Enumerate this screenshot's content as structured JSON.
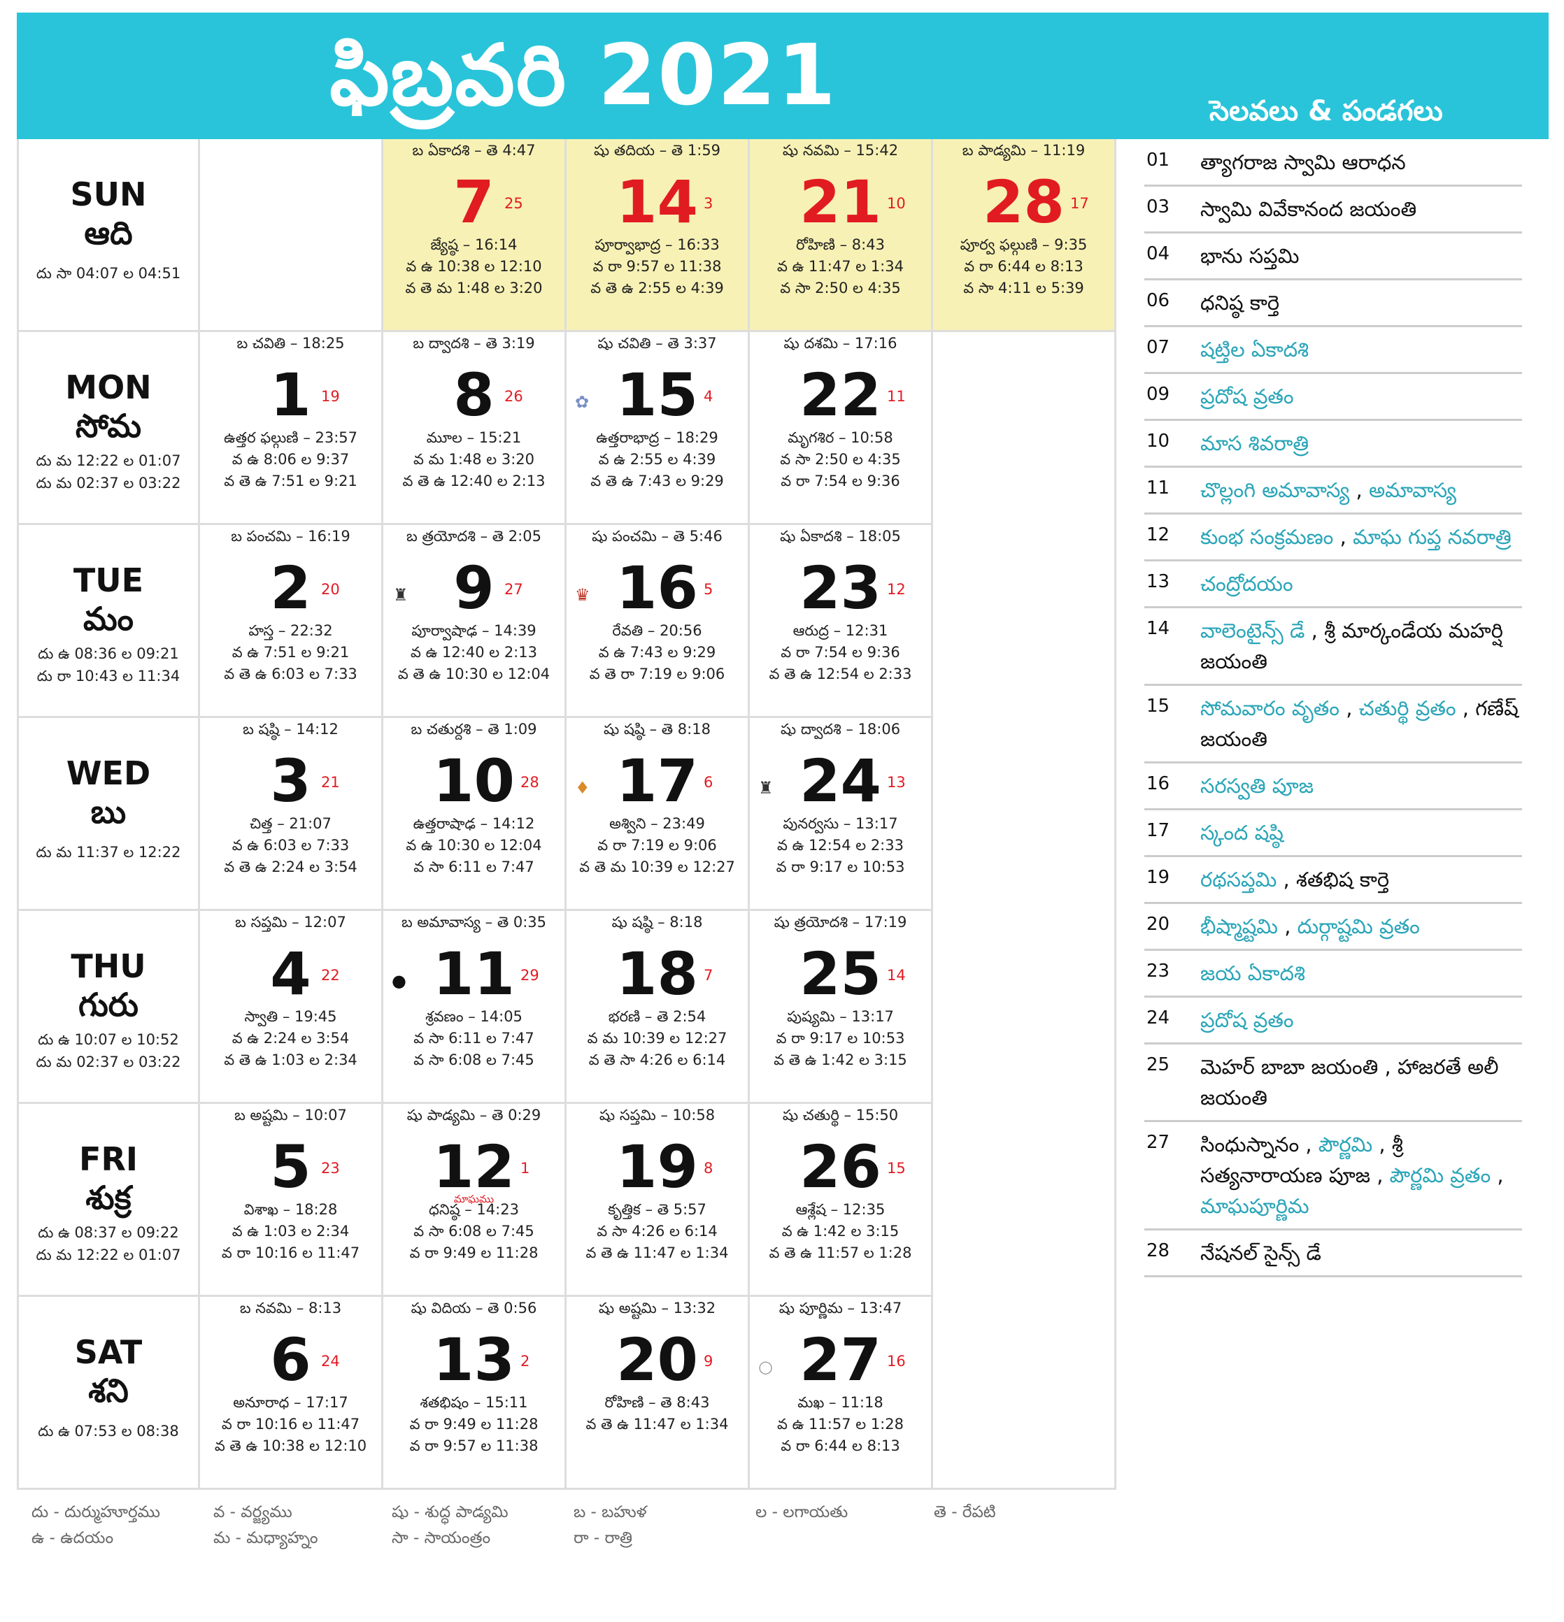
{
  "title": "ఫిబ్రవరి 2021",
  "festivals_title": "సెలవలు & పండగలు",
  "days": [
    {
      "en": "SUN",
      "te": "ఆది",
      "times": [
        "దు సా 04:07 ల 04:51"
      ]
    },
    {
      "en": "MON",
      "te": "సోమ",
      "times": [
        "దు మ 12:22 ల 01:07",
        "దు మ 02:37 ల 03:22"
      ]
    },
    {
      "en": "TUE",
      "te": "మం",
      "times": [
        "దు ఉ 08:36 ల 09:21",
        "దు రా 10:43 ల 11:34"
      ]
    },
    {
      "en": "WED",
      "te": "బు",
      "times": [
        "దు మ 11:37 ల 12:22"
      ]
    },
    {
      "en": "THU",
      "te": "గురు",
      "times": [
        "దు ఉ 10:07 ల 10:52",
        "దు మ 02:37 ల 03:22"
      ]
    },
    {
      "en": "FRI",
      "te": "శుక్ర",
      "times": [
        "దు ఉ 08:37 ల 09:22",
        "దు మ 12:22 ల 01:07"
      ]
    },
    {
      "en": "SAT",
      "te": "శని",
      "times": [
        "దు ఉ 07:53 ల 08:38"
      ]
    }
  ],
  "cells": [
    {
      "row": 0,
      "col": 1,
      "sun": true,
      "tithi": "బ ఏకాదశి – తె 4:47",
      "date": "7",
      "tdate": "25",
      "nak": "జ్యేష్ఠ – 16:14",
      "l1": "వ ఉ 10:38 ల 12:10",
      "l2": "వ తె మ 1:48 ల 3:20"
    },
    {
      "row": 0,
      "col": 2,
      "sun": true,
      "tithi": "షు తదియ – తె 1:59",
      "date": "14",
      "tdate": "3",
      "nak": "పూర్వాభాద్ర – 16:33",
      "l1": "వ రా 9:57 ల 11:38",
      "l2": "వ తె ఉ 2:55 ల 4:39"
    },
    {
      "row": 0,
      "col": 3,
      "sun": true,
      "tithi": "షు నవమి – 15:42",
      "date": "21",
      "tdate": "10",
      "nak": "రోహిణి – 8:43",
      "l1": "వ ఉ 11:47 ల 1:34",
      "l2": "వ సా 2:50 ల 4:35"
    },
    {
      "row": 0,
      "col": 4,
      "sun": true,
      "tithi": "బ పాడ్యమి – 11:19",
      "date": "28",
      "tdate": "17",
      "nak": "పూర్వ ఫల్గుణి – 9:35",
      "l1": "వ రా 6:44 ల 8:13",
      "l2": "వ సా 4:11 ల 5:39"
    },
    {
      "row": 1,
      "col": 0,
      "tithi": "బ చవితి – 18:25",
      "date": "1",
      "tdate": "19",
      "nak": "ఉత్తర ఫల్గుణి – 23:57",
      "l1": "వ ఉ 8:06 ల 9:37",
      "l2": "వ తె ఉ 7:51 ల 9:21"
    },
    {
      "row": 1,
      "col": 1,
      "tithi": "బ ద్వాదశి – తె 3:19",
      "date": "8",
      "tdate": "26",
      "nak": "మూల – 15:21",
      "l1": "వ మ 1:48 ల 3:20",
      "l2": "వ తె ఉ 12:40 ల 2:13"
    },
    {
      "row": 1,
      "col": 2,
      "tithi": "షు చవితి – తె 3:37",
      "date": "15",
      "tdate": "4",
      "nak": "ఉత్తరాభాద్ర – 18:29",
      "l1": "వ ఉ 2:55 ల 4:39",
      "l2": "వ తె ఉ 7:43 ల 9:29",
      "icon": "ganesha-icon",
      "glyph": "✿",
      "icolor": "#7a8fc4"
    },
    {
      "row": 1,
      "col": 3,
      "tithi": "షు దశమి – 17:16",
      "date": "22",
      "tdate": "11",
      "nak": "మృగశిర – 10:58",
      "l1": "వ సా 2:50 ల 4:35",
      "l2": "వ రా 7:54 ల 9:36"
    },
    {
      "row": 2,
      "col": 0,
      "tithi": "బ పంచమి – 16:19",
      "date": "2",
      "tdate": "20",
      "nak": "హస్త – 22:32",
      "l1": "వ ఉ 7:51 ల 9:21",
      "l2": "వ తె ఉ 6:03 ల 7:33"
    },
    {
      "row": 2,
      "col": 1,
      "tithi": "బ త్రయోదశి – తె 2:05",
      "date": "9",
      "tdate": "27",
      "nak": "పూర్వాషాఢ – 14:39",
      "l1": "వ ఉ 12:40 ల 2:13",
      "l2": "వ తె ఉ 10:30 ల 12:04",
      "icon": "shivalinga-icon",
      "glyph": "♜",
      "icolor": "#333"
    },
    {
      "row": 2,
      "col": 2,
      "tithi": "షు పంచమి – తె 5:46",
      "date": "16",
      "tdate": "5",
      "nak": "రేవతి – 20:56",
      "l1": "వ ఉ 7:43 ల 9:29",
      "l2": "వ తె రా 7:19 ల 9:06",
      "icon": "saraswati-icon",
      "glyph": "♛",
      "icolor": "#c0392b"
    },
    {
      "row": 2,
      "col": 3,
      "tithi": "షు ఏకాదశి – 18:05",
      "date": "23",
      "tdate": "12",
      "nak": "ఆరుద్ర – 12:31",
      "l1": "వ రా 7:54 ల 9:36",
      "l2": "వ తె ఉ 12:54 ల 2:33"
    },
    {
      "row": 3,
      "col": 0,
      "tithi": "బ షష్ఠి – 14:12",
      "date": "3",
      "tdate": "21",
      "nak": "చిత్త – 21:07",
      "l1": "వ ఉ 6:03 ల 7:33",
      "l2": "వ తె ఉ 2:24 ల 3:54"
    },
    {
      "row": 3,
      "col": 1,
      "tithi": "బ చతుర్దశి – తె 1:09",
      "date": "10",
      "tdate": "28",
      "nak": "ఉత్తరాషాఢ – 14:12",
      "l1": "వ ఉ 10:30 ల 12:04",
      "l2": "వ సా 6:11 ల 7:47"
    },
    {
      "row": 3,
      "col": 2,
      "tithi": "షు షష్ఠి – తె 8:18",
      "date": "17",
      "tdate": "6",
      "nak": "అశ్విని – 23:49",
      "l1": "వ రా 7:19 ల 9:06",
      "l2": "వ తె మ 10:39 ల 12:27",
      "icon": "skanda-icon",
      "glyph": "♦",
      "icolor": "#d98b2b"
    },
    {
      "row": 3,
      "col": 3,
      "tithi": "షు ద్వాదశి – 18:06",
      "date": "24",
      "tdate": "13",
      "nak": "పునర్వసు – 13:17",
      "l1": "వ ఉ 12:54 ల 2:33",
      "l2": "వ రా 9:17 ల 10:53",
      "icon": "shivalinga-icon",
      "glyph": "♜",
      "icolor": "#333"
    },
    {
      "row": 4,
      "col": 0,
      "tithi": "బ సప్తమి – 12:07",
      "date": "4",
      "tdate": "22",
      "nak": "స్వాతి – 19:45",
      "l1": "వ ఉ 2:24 ల 3:54",
      "l2": "వ తె ఉ 1:03 ల 2:34"
    },
    {
      "row": 4,
      "col": 1,
      "tithi": "బ అమావాస్య – తె 0:35",
      "date": "11",
      "tdate": "29",
      "nak": "శ్రవణం – 14:05",
      "l1": "వ సా 6:11 ల 7:47",
      "l2": "వ సా 6:08 ల 7:45",
      "icon": "new-moon-icon",
      "glyph": "●",
      "icolor": "#111"
    },
    {
      "row": 4,
      "col": 2,
      "tithi": "షు షష్ఠి – 8:18",
      "date": "18",
      "tdate": "7",
      "nak": "భరణి – తె 2:54",
      "l1": "వ మ 10:39 ల 12:27",
      "l2": "వ తె సా 4:26 ల 6:14"
    },
    {
      "row": 4,
      "col": 3,
      "tithi": "షు త్రయోదశి – 17:19",
      "date": "25",
      "tdate": "14",
      "nak": "పుష్యమి – 13:17",
      "l1": "వ రా 9:17 ల 10:53",
      "l2": "వ తె ఉ 1:42 ల 3:15"
    },
    {
      "row": 5,
      "col": 0,
      "tithi": "బ అష్టమి – 10:07",
      "date": "5",
      "tdate": "23",
      "nak": "విశాఖ – 18:28",
      "l1": "వ ఉ 1:03 ల 2:34",
      "l2": "వ రా 10:16 ల 11:47"
    },
    {
      "row": 5,
      "col": 1,
      "tithi": "షు పాడ్యమి – తె 0:29",
      "date": "12",
      "tdate": "1",
      "note": "మాఘము",
      "nak": "ధనిష్ఠ – 14:23",
      "l1": "వ సా 6:08 ల 7:45",
      "l2": "వ రా 9:49 ల 11:28"
    },
    {
      "row": 5,
      "col": 2,
      "tithi": "షు సప్తమి – 10:58",
      "date": "19",
      "tdate": "8",
      "nak": "కృత్తిక – తె 5:57",
      "l1": "వ సా 4:26 ల 6:14",
      "l2": "వ తె ఉ 11:47 ల 1:34"
    },
    {
      "row": 5,
      "col": 3,
      "tithi": "షు చతుర్థి – 15:50",
      "date": "26",
      "tdate": "15",
      "nak": "ఆశ్లేష – 12:35",
      "l1": "వ ఉ 1:42 ల 3:15",
      "l2": "వ తె ఉ 11:57 ల 1:28"
    },
    {
      "row": 6,
      "col": 0,
      "tithi": "బ నవమి – 8:13",
      "date": "6",
      "tdate": "24",
      "nak": "అనూరాధ – 17:17",
      "l1": "వ రా 10:16 ల 11:47",
      "l2": "వ తె ఉ 10:38 ల 12:10"
    },
    {
      "row": 6,
      "col": 1,
      "tithi": "షు విదియ – తె 0:56",
      "date": "13",
      "tdate": "2",
      "nak": "శతభిషం – 15:11",
      "l1": "వ రా 9:49 ల 11:28",
      "l2": "వ రా 9:57 ల 11:38"
    },
    {
      "row": 6,
      "col": 2,
      "tithi": "షు అష్టమి – 13:32",
      "date": "20",
      "tdate": "9",
      "nak": "రోహిణి – తె 8:43",
      "l1": "వ తె ఉ 11:47 ల 1:34",
      "l2": ""
    },
    {
      "row": 6,
      "col": 3,
      "tithi": "షు పూర్ణిమ – 13:47",
      "date": "27",
      "tdate": "16",
      "nak": "మఖ – 11:18",
      "l1": "వ ఉ 11:57 ల 1:28",
      "l2": "వ రా 6:44 ల 8:13",
      "icon": "full-moon-icon",
      "glyph": "○",
      "icolor": "#999"
    }
  ],
  "legend": [
    "దు - దుర్ముహూర్తము",
    "ఉ - ఉదయం",
    "వ - వర్జ్యము",
    "మ - మధ్యాహ్నం",
    "షు - శుద్ధ పాడ్యమి",
    "సా - సాయంత్రం",
    "బ - బహుళ",
    "రా - రాత్రి",
    "ల - లగాయతు",
    "తె - రేపటి"
  ],
  "festivals": [
    {
      "num": "01",
      "parts": [
        {
          "t": "త్యాగరాజ స్వామి ఆరాధన",
          "c": "dark"
        }
      ]
    },
    {
      "num": "03",
      "parts": [
        {
          "t": "స్వామి వివేకానంద జయంతి",
          "c": "dark"
        }
      ]
    },
    {
      "num": "04",
      "parts": [
        {
          "t": "భాను సప్తమి",
          "c": "dark"
        }
      ]
    },
    {
      "num": "06",
      "parts": [
        {
          "t": "ధనిష్ఠ కార్తె",
          "c": "dark"
        }
      ]
    },
    {
      "num": "07",
      "parts": [
        {
          "t": "షట్తిల ఏకాదశి",
          "c": "blue"
        }
      ]
    },
    {
      "num": "09",
      "parts": [
        {
          "t": "ప్రదోష వ్రతం",
          "c": "blue"
        }
      ]
    },
    {
      "num": "10",
      "parts": [
        {
          "t": "మాస శివరాత్రి",
          "c": "blue"
        }
      ]
    },
    {
      "num": "11",
      "parts": [
        {
          "t": "చొల్లంగి అమావాస్య",
          "c": "blue"
        },
        {
          "t": " , ",
          "c": "dark"
        },
        {
          "t": "అమావాస్య",
          "c": "blue"
        }
      ]
    },
    {
      "num": "12",
      "parts": [
        {
          "t": "కుంభ సంక్రమణం",
          "c": "blue"
        },
        {
          "t": " , ",
          "c": "dark"
        },
        {
          "t": "మాఘ గుప్త నవరాత్రి",
          "c": "blue"
        }
      ]
    },
    {
      "num": "13",
      "parts": [
        {
          "t": "చంద్రోదయం",
          "c": "blue"
        }
      ]
    },
    {
      "num": "14",
      "parts": [
        {
          "t": "వాలెంటైన్స్ డే",
          "c": "blue"
        },
        {
          "t": " , శ్రీ మార్కండేయ మహర్షి జయంతి",
          "c": "dark"
        }
      ]
    },
    {
      "num": "15",
      "parts": [
        {
          "t": "సోమవారం వృతం",
          "c": "blue"
        },
        {
          "t": " , ",
          "c": "dark"
        },
        {
          "t": "చతుర్థి వ్రతం",
          "c": "blue"
        },
        {
          "t": " , గణేష్ జయంతి",
          "c": "dark"
        }
      ]
    },
    {
      "num": "16",
      "parts": [
        {
          "t": "సరస్వతి పూజ",
          "c": "blue"
        }
      ]
    },
    {
      "num": "17",
      "parts": [
        {
          "t": "స్కంద షష్ఠి",
          "c": "blue"
        }
      ]
    },
    {
      "num": "19",
      "parts": [
        {
          "t": "రథసప్తమి",
          "c": "blue"
        },
        {
          "t": " , శతభిష కార్తె",
          "c": "dark"
        }
      ]
    },
    {
      "num": "20",
      "parts": [
        {
          "t": "భీష్మాష్టమి",
          "c": "blue"
        },
        {
          "t": " , ",
          "c": "dark"
        },
        {
          "t": "దుర్గాష్టమి వ్రతం",
          "c": "blue"
        }
      ]
    },
    {
      "num": "23",
      "parts": [
        {
          "t": "జయ ఏకాదశి",
          "c": "blue"
        }
      ]
    },
    {
      "num": "24",
      "parts": [
        {
          "t": "ప్రదోష వ్రతం",
          "c": "blue"
        }
      ]
    },
    {
      "num": "25",
      "parts": [
        {
          "t": "మెహర్ బాబా జయంతి , హాజరతే అలీ జయంతి",
          "c": "dark"
        }
      ]
    },
    {
      "num": "27",
      "parts": [
        {
          "t": "సింధుస్నానం , ",
          "c": "dark"
        },
        {
          "t": "పౌర్ణమి",
          "c": "blue"
        },
        {
          "t": " , శ్రీ సత్యనారాయణ పూజ , ",
          "c": "dark"
        },
        {
          "t": "పౌర్ణమి వ్రతం",
          "c": "blue"
        },
        {
          "t": " , ",
          "c": "dark"
        },
        {
          "t": "మాఘపూర్ణిమ",
          "c": "blue"
        }
      ]
    },
    {
      "num": "28",
      "parts": [
        {
          "t": "నేషనల్ సైన్స్ డే",
          "c": "dark"
        }
      ]
    }
  ]
}
